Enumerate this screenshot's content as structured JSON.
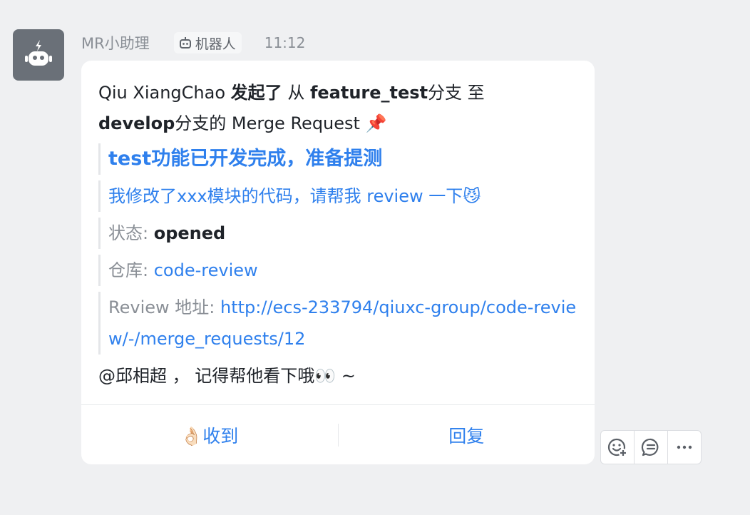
{
  "sender": {
    "name": "MR小助理",
    "badge": "机器人",
    "time": "11:12"
  },
  "message": {
    "intro": {
      "author": "Qiu XiangChao",
      "verb": "发起了",
      "from_word": "从",
      "source_branch": "feature_test",
      "branch_word_1": "分支 至",
      "target_branch": "develop",
      "branch_word_2": "分支的 Merge Request 📌"
    },
    "title": "test功能已开发完成，准备提测",
    "description": "我修改了xxx模块的代码，请帮我 review 一下😼",
    "status_label": "状态: ",
    "status_value": "opened",
    "repo_label": "仓库: ",
    "repo_value": "code-review",
    "review_label": "Review 地址: ",
    "review_url": "http://ecs-233794/qiuxc-group/code-review/-/merge_requests/12",
    "mention": "@邱相超 ，  记得帮他看下哦👀 ~"
  },
  "actions": {
    "ack": "👌🏻收到",
    "reply": "回复"
  },
  "toolbar": {
    "icons": [
      "add-reaction-icon",
      "comment-icon",
      "more-icon"
    ]
  }
}
